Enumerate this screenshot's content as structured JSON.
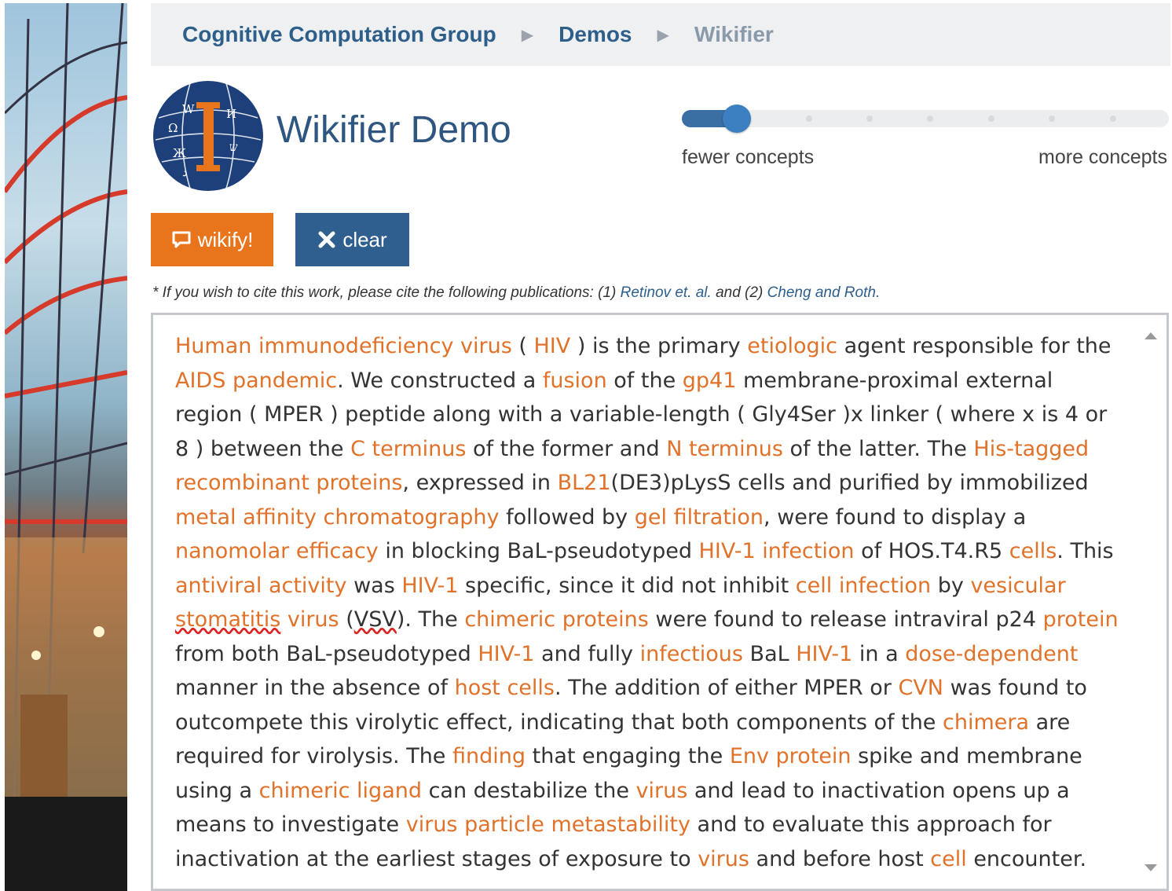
{
  "breadcrumb": {
    "items": [
      "Cognitive Computation Group",
      "Demos",
      "Wikifier"
    ]
  },
  "header": {
    "title": "Wikifier Demo"
  },
  "slider": {
    "min_label": "fewer concepts",
    "max_label": "more concepts",
    "value": 0.1,
    "steps": 8
  },
  "buttons": {
    "wikify_label": "wikify!",
    "clear_label": "clear"
  },
  "citation": {
    "prefix": "* If you wish to cite this work, please cite the following publications: (1) ",
    "pub1": "Retinov et. al.",
    "middle": " and (2) ",
    "pub2": "Cheng and Roth."
  },
  "text_segments": [
    {
      "t": "Human immunodeficiency virus",
      "c": 1
    },
    {
      "t": " ( "
    },
    {
      "t": "HIV",
      "c": 1
    },
    {
      "t": " ) is the primary "
    },
    {
      "t": "etiologic",
      "c": 1
    },
    {
      "t": " agent responsible for the "
    },
    {
      "t": "AIDS pandemic",
      "c": 1
    },
    {
      "t": ". We constructed a "
    },
    {
      "t": "fusion",
      "c": 1
    },
    {
      "t": " of the "
    },
    {
      "t": "gp41",
      "c": 1
    },
    {
      "t": " membrane-proximal external region ( MPER ) peptide along with a variable-length ( Gly4Ser )x linker ( where x is 4 or 8 ) between the "
    },
    {
      "t": "C terminus",
      "c": 1
    },
    {
      "t": " of the former and "
    },
    {
      "t": "N terminus",
      "c": 1
    },
    {
      "t": " of the latter. The "
    },
    {
      "t": "His-tagged recombinant proteins",
      "c": 1
    },
    {
      "t": ", expressed in "
    },
    {
      "t": "BL21",
      "c": 1
    },
    {
      "t": "(DE3)pLysS cells and purified by immobilized "
    },
    {
      "t": "metal affinity chromatography",
      "c": 1
    },
    {
      "t": " followed by "
    },
    {
      "t": "gel filtration",
      "c": 1
    },
    {
      "t": ", were found to display a "
    },
    {
      "t": "nanomolar efficacy",
      "c": 1
    },
    {
      "t": " in blocking BaL-pseudotyped "
    },
    {
      "t": "HIV-1 infection",
      "c": 1
    },
    {
      "t": " of HOS.T4.R5 "
    },
    {
      "t": "cells",
      "c": 1
    },
    {
      "t": ". This "
    },
    {
      "t": "antiviral activity",
      "c": 1
    },
    {
      "t": " was "
    },
    {
      "t": "HIV-1",
      "c": 1
    },
    {
      "t": " specific, since it did not inhibit "
    },
    {
      "t": "cell infection",
      "c": 1
    },
    {
      "t": " by "
    },
    {
      "t": "vesicular ",
      "c": 1
    },
    {
      "t": "stomatitis",
      "c": 1,
      "u": 1
    },
    {
      "t": " virus",
      "c": 1
    },
    {
      "t": " ("
    },
    {
      "t": "VSV",
      "u": 1
    },
    {
      "t": "). The "
    },
    {
      "t": "chimeric proteins",
      "c": 1
    },
    {
      "t": " were found to release intraviral p24 "
    },
    {
      "t": "protein",
      "c": 1
    },
    {
      "t": " from both BaL-pseudotyped "
    },
    {
      "t": "HIV-1",
      "c": 1
    },
    {
      "t": " and fully "
    },
    {
      "t": "infectious",
      "c": 1
    },
    {
      "t": " BaL "
    },
    {
      "t": "HIV-1",
      "c": 1
    },
    {
      "t": " in a "
    },
    {
      "t": "dose-dependent",
      "c": 1
    },
    {
      "t": " manner in the absence of "
    },
    {
      "t": "host cells",
      "c": 1
    },
    {
      "t": ". The addition of either MPER or "
    },
    {
      "t": "CVN",
      "c": 1
    },
    {
      "t": " was found to outcompete this virolytic effect, indicating that both components of the "
    },
    {
      "t": "chimera",
      "c": 1
    },
    {
      "t": " are required for virolysis. The "
    },
    {
      "t": "finding",
      "c": 1
    },
    {
      "t": " that engaging the "
    },
    {
      "t": "Env protein",
      "c": 1
    },
    {
      "t": " spike and membrane using a "
    },
    {
      "t": "chimeric ligand",
      "c": 1
    },
    {
      "t": " can destabilize the "
    },
    {
      "t": "virus",
      "c": 1
    },
    {
      "t": " and lead to inactivation opens up a means to investigate "
    },
    {
      "t": "virus particle metastability",
      "c": 1
    },
    {
      "t": " and to evaluate this approach for inactivation at the earliest stages of exposure to "
    },
    {
      "t": "virus",
      "c": 1
    },
    {
      "t": " and before host "
    },
    {
      "t": "cell",
      "c": 1
    },
    {
      "t": " encounter."
    }
  ],
  "colors": {
    "concept": "#e0722a",
    "wikify_button": "#e8741c",
    "clear_button": "#2e5f8e",
    "title": "#2e5680"
  },
  "icons": [
    "wikipedia-globe-logo",
    "chat-bubble-icon",
    "close-icon",
    "scroll-up-icon",
    "scroll-down-icon"
  ]
}
